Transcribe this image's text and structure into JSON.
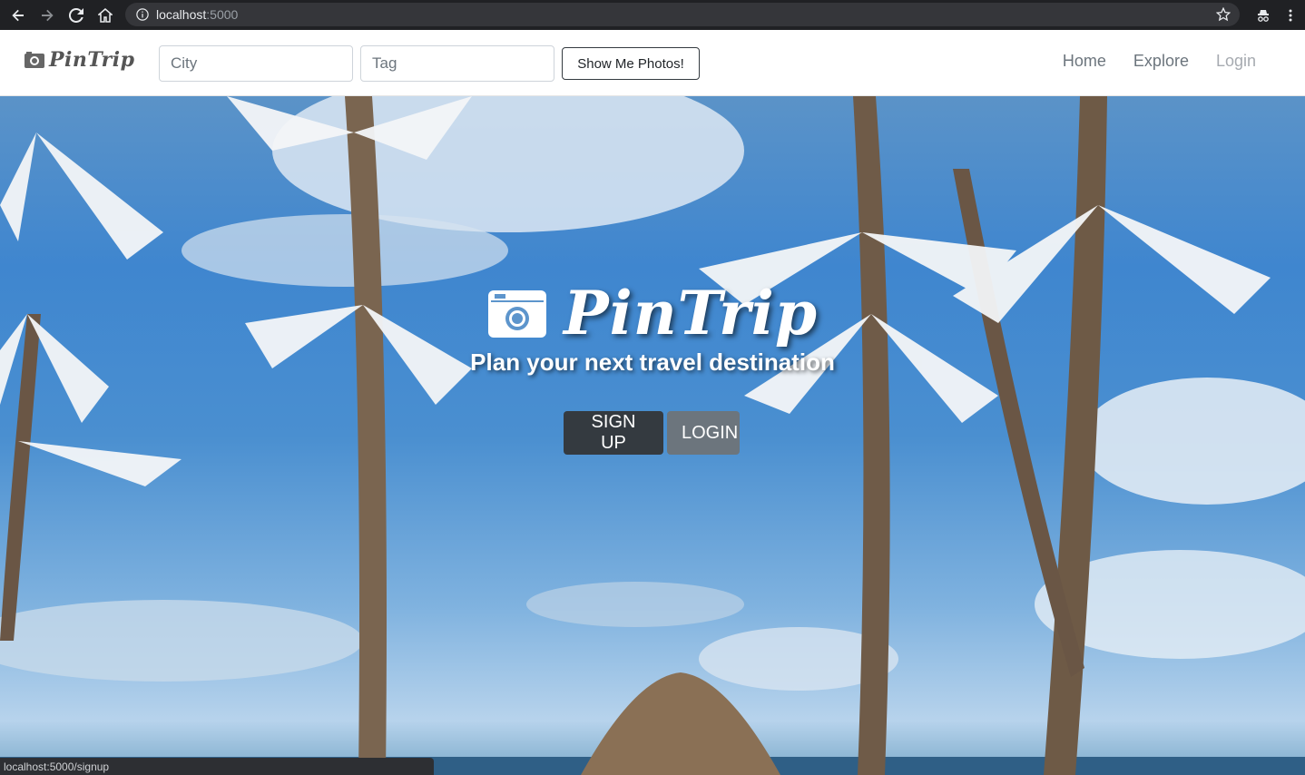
{
  "browser": {
    "url_host": "localhost",
    "url_port": ":5000",
    "status_url": "localhost:5000/signup"
  },
  "navbar": {
    "brand": "PinTrip",
    "city_placeholder": "City",
    "tag_placeholder": "Tag",
    "search_button": "Show Me Photos!",
    "links": [
      "Home",
      "Explore",
      "Login"
    ]
  },
  "hero": {
    "title": "PinTrip",
    "subtitle": "Plan your next travel destination",
    "signup_label": "SIGN UP",
    "login_label": "LOGIN"
  },
  "colors": {
    "chrome_bg": "#202124",
    "primary_dark": "#343a40",
    "secondary": "#6c757d",
    "sky": "#4a8fd0"
  },
  "icons": [
    "back-icon",
    "forward-icon",
    "reload-icon",
    "home-icon",
    "info-icon",
    "star-icon",
    "incognito-icon",
    "menu-icon",
    "camera-icon"
  ]
}
